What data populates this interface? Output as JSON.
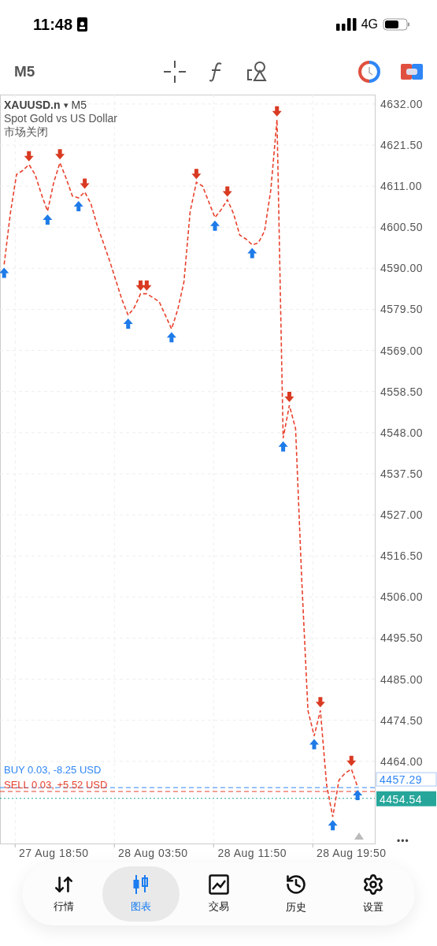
{
  "status_bar": {
    "time": "11:48",
    "network": "4G"
  },
  "toolbar": {
    "timeframe": "M5"
  },
  "chart": {
    "symbol": "XAUUSD.n",
    "dropdown": "▾",
    "timeframe": "M5",
    "description": "Spot Gold vs US Dollar",
    "market_status": "市场关闭",
    "more": "•••",
    "chart_data": {
      "type": "line",
      "categories": [
        null,
        null,
        null,
        null,
        null,
        null,
        null,
        null,
        "27 Aug 18:50",
        null,
        null,
        null,
        null,
        null,
        null,
        null,
        null,
        null,
        null,
        null,
        null,
        null,
        null,
        null,
        "28 Aug 03:50",
        null,
        null,
        null,
        null,
        null,
        null,
        null,
        null,
        null,
        null,
        null,
        null,
        null,
        null,
        null,
        "28 Aug 11:50",
        null,
        null,
        null,
        null,
        null,
        null,
        null,
        null,
        null,
        null,
        null,
        null,
        null,
        null,
        null,
        "28 Aug 19:50",
        null
      ],
      "grid": true,
      "series": [
        {
          "color": "#e8412c",
          "line_style": "dashed",
          "values": [
            4591,
            4604,
            4614,
            4615,
            4616.5,
            4614,
            4609,
            4604.6,
            4612,
            4617,
            4613,
            4608.5,
            4608,
            4609.5,
            4606.5,
            4601,
            4596.5,
            4592,
            4587,
            4582,
            4578,
            4580,
            4583.5,
            4583.5,
            4582.5,
            4581.5,
            4578,
            4574.5,
            4579.5,
            4586.5,
            4604.5,
            4612,
            4611,
            4607,
            4603,
            4605,
            4607.5,
            4604,
            4598.5,
            4597.5,
            4596,
            4596.5,
            4599.5,
            4610,
            4628,
            4546.6,
            4555,
            4549,
            4510,
            4477,
            4470.5,
            4477,
            4458,
            4449.8,
            4459.2,
            4461,
            4462,
            4457.5
          ]
        }
      ],
      "ylim": [
        4443.0,
        4634.4
      ],
      "yticks": [
        {
          "value": 4632,
          "label": "4632.00"
        },
        {
          "value": 4621.5,
          "label": "4621.50"
        },
        {
          "value": 4611,
          "label": "4611.00"
        },
        {
          "value": 4600.5,
          "label": "4600.50"
        },
        {
          "value": 4590,
          "label": "4590.00"
        },
        {
          "value": 4579.5,
          "label": "4579.50"
        },
        {
          "value": 4569,
          "label": "4569.00"
        },
        {
          "value": 4558.5,
          "label": "4558.50"
        },
        {
          "value": 4548,
          "label": "4548.00"
        },
        {
          "value": 4537.5,
          "label": "4537.50"
        },
        {
          "value": 4527,
          "label": "4527.00"
        },
        {
          "value": 4516.5,
          "label": "4516.50"
        },
        {
          "value": 4506,
          "label": "4506.00"
        },
        {
          "value": 4495.5,
          "label": "4495.50"
        },
        {
          "value": 4485,
          "label": "4485.00"
        },
        {
          "value": 4474.5,
          "label": "4474.50"
        },
        {
          "value": 4464,
          "label": "4464.00"
        }
      ],
      "ref_lines": [
        {
          "axis": "y",
          "value": 4457.29,
          "label": "BUY 0.03, -8.25 USD",
          "color": "#2f86f6"
        },
        {
          "axis": "y",
          "value": 4456.3,
          "label": "SELL 0.03, +5.52 USD",
          "color": "#e8412c"
        },
        {
          "axis": "y",
          "value": 4454.54,
          "color": "#26a69a"
        }
      ]
    },
    "price_tags": [
      {
        "kind": "order",
        "text": "4457.29"
      },
      {
        "kind": "bid",
        "text": "4454.54"
      }
    ]
  },
  "nav": [
    {
      "kind": "quotes",
      "label": "行情",
      "selected": false
    },
    {
      "kind": "chart",
      "label": "图表",
      "selected": true
    },
    {
      "kind": "trade",
      "label": "交易",
      "selected": false
    },
    {
      "kind": "history",
      "label": "历史",
      "selected": false
    },
    {
      "kind": "settings",
      "label": "设置",
      "selected": false
    }
  ]
}
